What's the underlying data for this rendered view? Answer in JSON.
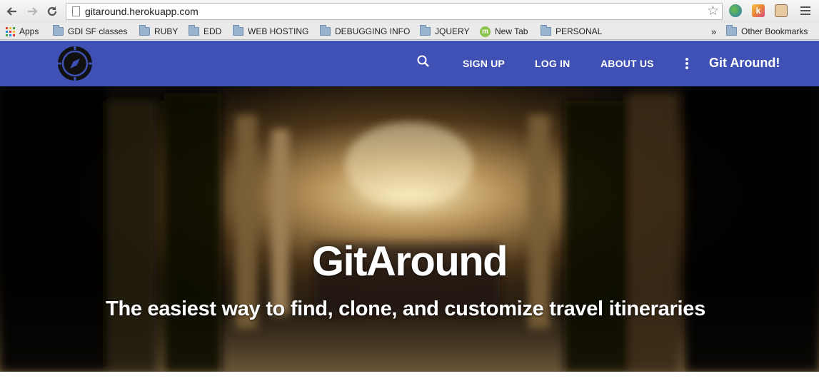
{
  "browser": {
    "url": "gitaround.herokuapp.com",
    "bookmarks": [
      {
        "label": "Apps",
        "icon": "apps-grid-icon"
      },
      {
        "label": "GDI SF classes",
        "icon": "folder-icon"
      },
      {
        "label": "RUBY",
        "icon": "folder-icon"
      },
      {
        "label": "EDD",
        "icon": "folder-icon"
      },
      {
        "label": "WEB HOSTING",
        "icon": "folder-icon"
      },
      {
        "label": "DEBUGGING INFO",
        "icon": "folder-icon"
      },
      {
        "label": "JQUERY",
        "icon": "folder-icon"
      },
      {
        "label": "New Tab",
        "icon": "m-icon"
      },
      {
        "label": "PERSONAL",
        "icon": "folder-icon"
      }
    ],
    "overflow_chevron": "»",
    "other_bookmarks": "Other Bookmarks"
  },
  "nav": {
    "links": [
      "SIGN UP",
      "LOG IN",
      "ABOUT US"
    ],
    "brand": "Git Around!",
    "bar_color": "#3f51b5"
  },
  "hero": {
    "title": "GitAround",
    "subtitle": "The easiest way to find, clone, and customize travel itineraries"
  }
}
